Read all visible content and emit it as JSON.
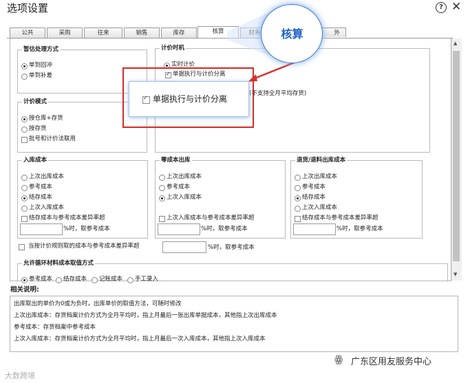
{
  "window": {
    "title": "选项设置",
    "help_icon": "?",
    "close_icon": "✕"
  },
  "tabs": [
    {
      "label": "公共"
    },
    {
      "label": "采购"
    },
    {
      "label": "往来"
    },
    {
      "label": "销售"
    },
    {
      "label": "库存"
    },
    {
      "label": "核算"
    },
    {
      "label": "财务"
    },
    {
      "label": "..."
    },
    {
      "label": "外"
    }
  ],
  "groups": {
    "tmp_method": {
      "title": "暂估处理方式",
      "options": [
        "单到回冲",
        "单到补差"
      ],
      "selected": 0
    },
    "pricing_mode": {
      "title": "计价模式",
      "options": [
        "按仓库+存货",
        "按存货"
      ],
      "selected": 0,
      "checkbox": "批号和计价法联用"
    },
    "pricing_timing": {
      "title": "计价时机",
      "option_realtime": "实时计价",
      "checkbox_separate": "单据执行与计价分离",
      "note": "(不支持全月平均存货)"
    },
    "inbound_cost": {
      "title": "入库成本",
      "options": [
        "上次出库成本",
        "参考成本",
        "结存成本",
        "上次入库成本"
      ],
      "selected": 2,
      "checkbox": "结存成本与参考成本差异率超",
      "suffix": "%时，取参考成本"
    },
    "zero_cost_out": {
      "title": "零成本出库",
      "options": [
        "上次出库成本",
        "参考成本",
        "上次入库成本"
      ],
      "selected": 2,
      "checkbox": "上次入库成本与参考成本差异率超",
      "suffix": "%时，取参考成本"
    },
    "return_cost": {
      "title": "退货/退料出库成本",
      "options": [
        "上次出库成本",
        "参考成本",
        "结存成本",
        "上次入库成本"
      ],
      "selected": 2,
      "checkbox": "结存成本与参考成本差异率超",
      "suffix": "%时，取参考成本"
    }
  },
  "rule_line": {
    "label": "当按计价规则取的成本与参考成本差异率超",
    "suffix": "%时，取参考成本"
  },
  "cyclic_material": {
    "title": "允许循环材料成本取值方式",
    "options": [
      "参考成本",
      "结存成本",
      "记账成本",
      "手工录入"
    ],
    "selected": 0
  },
  "explanation": {
    "title": "相关说明:",
    "lines": [
      "出库取出的单价为0或为负时，出库单价的取值方法，可随时修改",
      "上次出库成本：存货档案计价方式为全月平均时，指上月最后一张出库单据成本，其他指上次出库成本",
      "参考成本：存货档案中参考成本",
      "上次入库成本：存货档案计价方式为全月平均时，指上月最后一次入库成本，其他指上次入库成本"
    ]
  },
  "annotations": {
    "circle_label": "核算",
    "zoom_checkbox": "单据执行与计价分离"
  },
  "watermarks": {
    "left": "大数跨境",
    "right": "广东区用友服务中心"
  },
  "colors": {
    "accent": "#1e63c6",
    "highlight_red": "#d22a24",
    "arrow_red": "#d8322b"
  }
}
